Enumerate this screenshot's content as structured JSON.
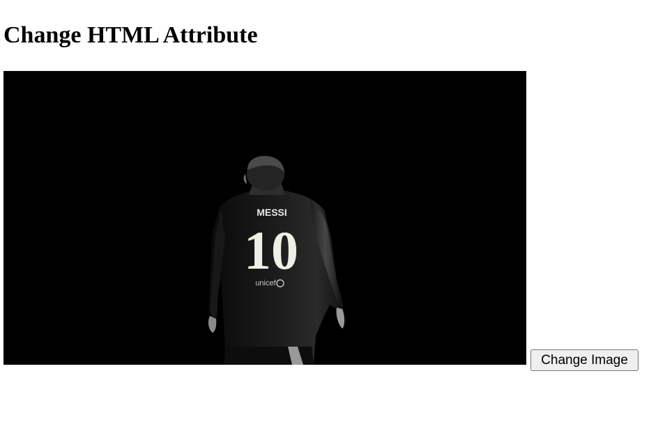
{
  "page": {
    "title": "Change HTML Attribute"
  },
  "photo": {
    "jersey_name": "MESSI",
    "jersey_number": "10",
    "sponsor": "unicef"
  },
  "controls": {
    "change_image_label": "Change Image"
  }
}
